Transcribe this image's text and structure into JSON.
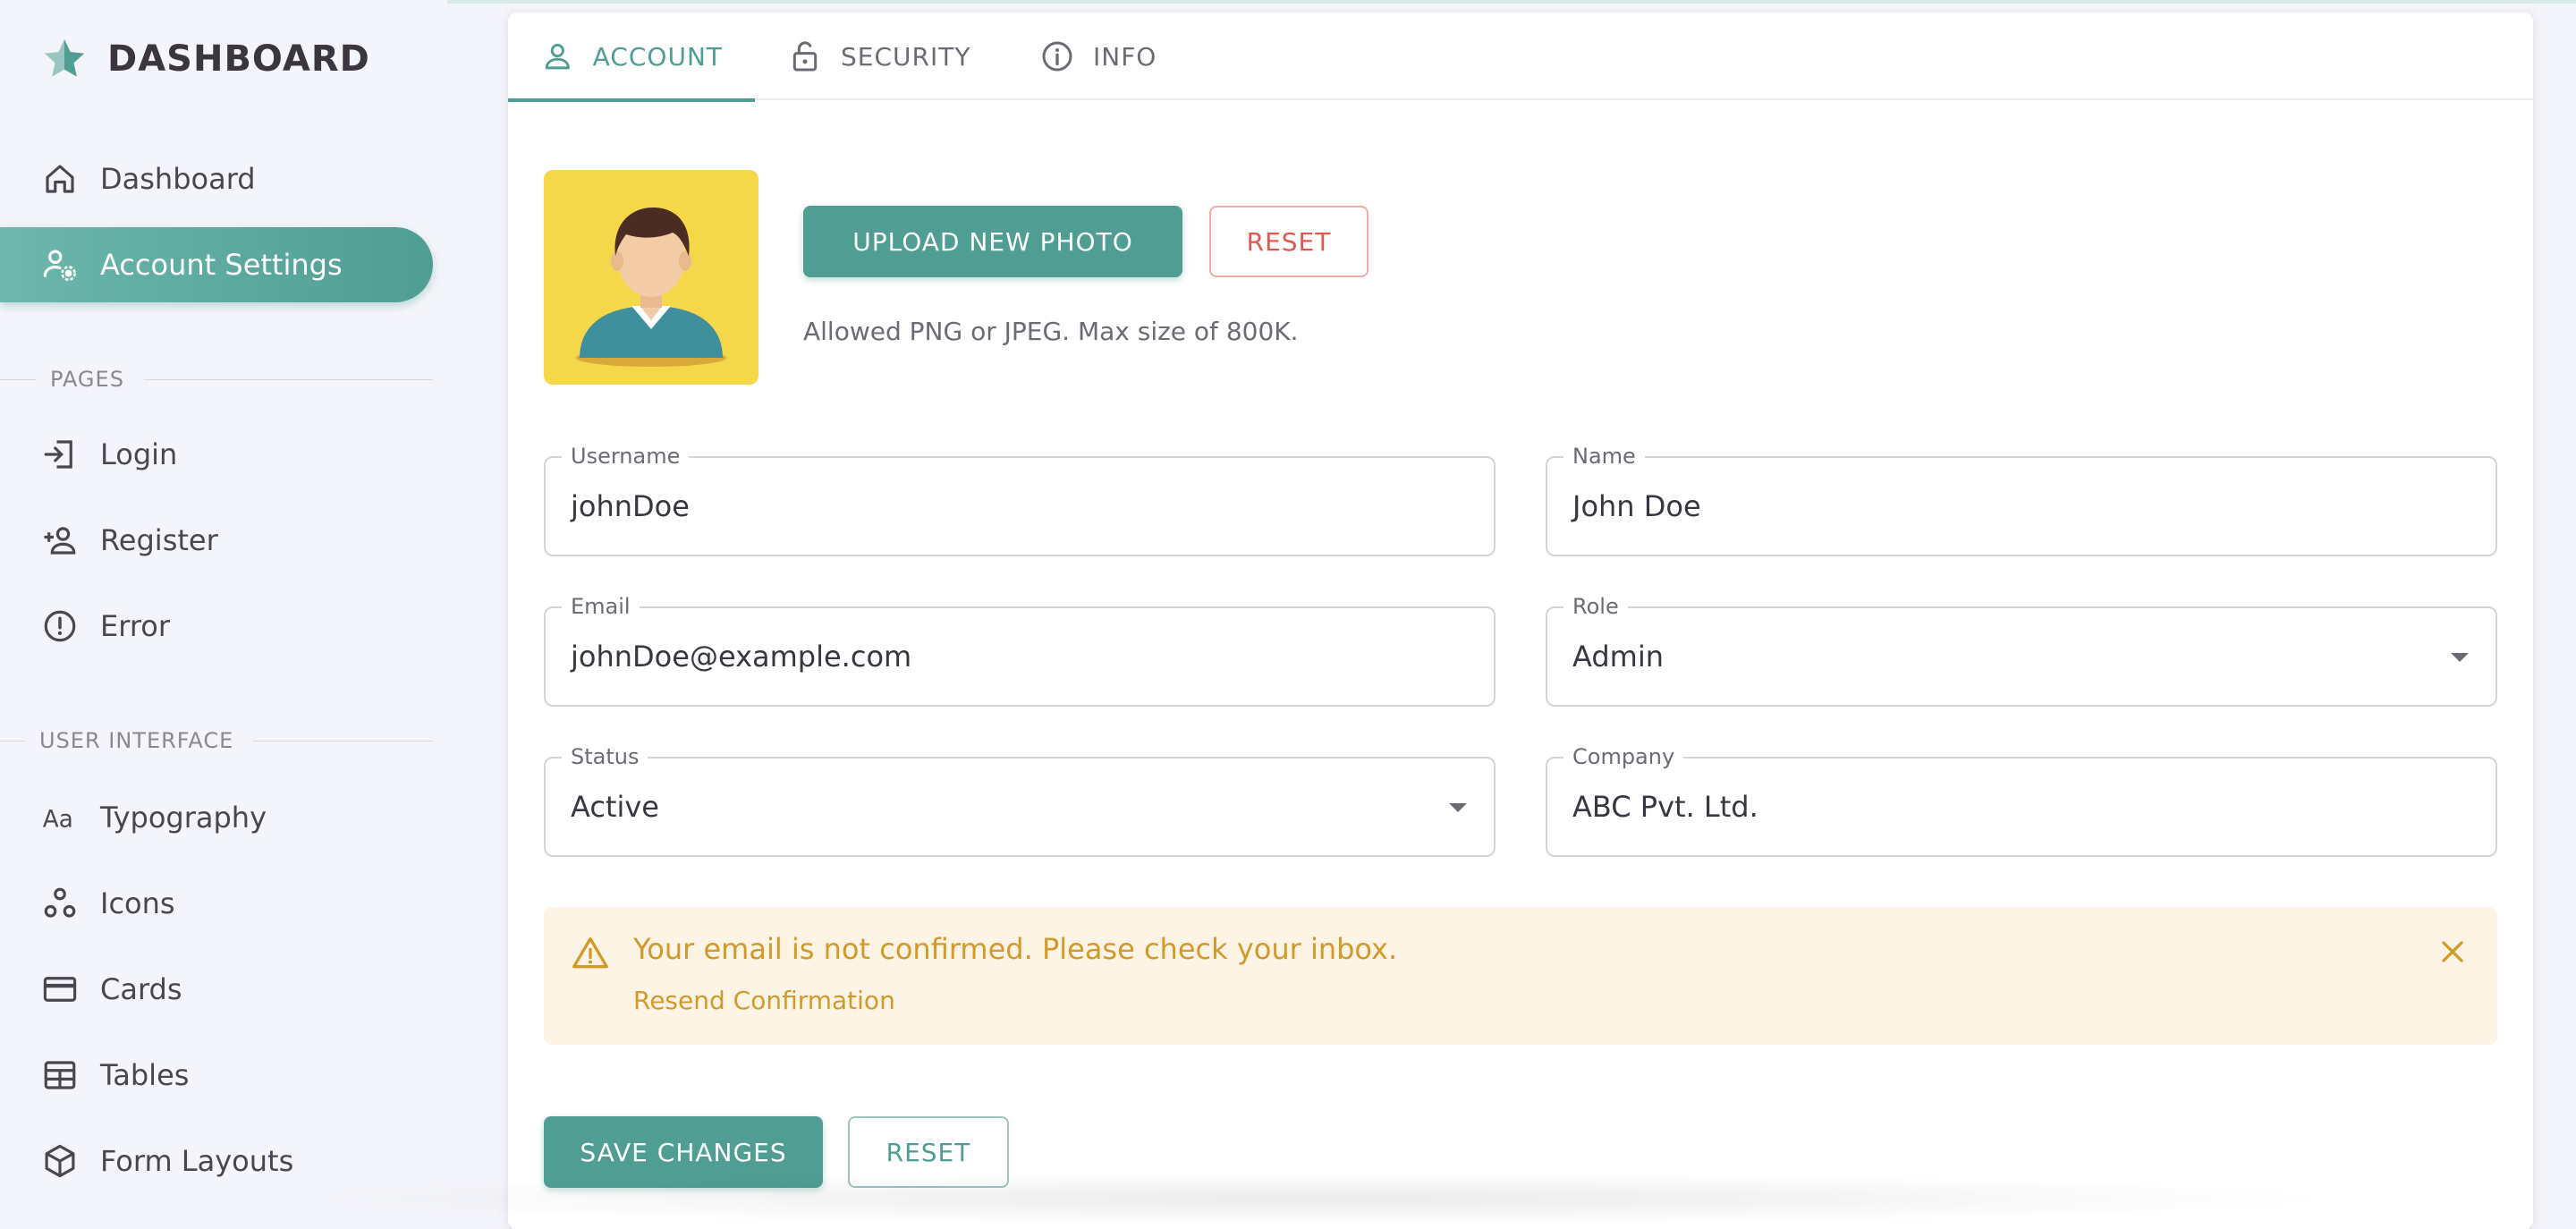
{
  "sidebar": {
    "brand": {
      "title": "DASHBOARD",
      "icon": "star-icon"
    },
    "top_items": [
      {
        "label": "Dashboard",
        "icon": "home-icon",
        "active": false
      },
      {
        "label": "Account Settings",
        "icon": "account-cog-icon",
        "active": true
      }
    ],
    "sections": [
      {
        "title": "PAGES",
        "items": [
          {
            "label": "Login",
            "icon": "login-icon"
          },
          {
            "label": "Register",
            "icon": "account-plus-icon"
          },
          {
            "label": "Error",
            "icon": "alert-circle-icon"
          }
        ]
      },
      {
        "title": "USER INTERFACE",
        "items": [
          {
            "label": "Typography",
            "icon": "typography-icon"
          },
          {
            "label": "Icons",
            "icon": "google-circles-icon"
          },
          {
            "label": "Cards",
            "icon": "credit-card-icon"
          },
          {
            "label": "Tables",
            "icon": "table-icon"
          },
          {
            "label": "Form Layouts",
            "icon": "cube-icon"
          }
        ]
      }
    ]
  },
  "tabs": [
    {
      "label": "ACCOUNT",
      "icon": "account-outline-icon",
      "active": true
    },
    {
      "label": "SECURITY",
      "icon": "lock-open-icon",
      "active": false
    },
    {
      "label": "INFO",
      "icon": "info-icon",
      "active": false
    }
  ],
  "photo": {
    "upload_label": "UPLOAD NEW PHOTO",
    "reset_label": "RESET",
    "hint": "Allowed PNG or JPEG. Max size of 800K."
  },
  "form": {
    "username": {
      "label": "Username",
      "value": "johnDoe"
    },
    "name": {
      "label": "Name",
      "value": "John Doe"
    },
    "email": {
      "label": "Email",
      "value": "johnDoe@example.com"
    },
    "role": {
      "label": "Role",
      "value": "Admin"
    },
    "status": {
      "label": "Status",
      "value": "Active"
    },
    "company": {
      "label": "Company",
      "value": "ABC Pvt. Ltd."
    }
  },
  "alert": {
    "message": "Your email is not confirmed. Please check your inbox.",
    "link": "Resend Confirmation"
  },
  "actions": {
    "save_label": "SAVE CHANGES",
    "reset_label": "RESET"
  },
  "colors": {
    "primary": "#4f9d93",
    "warning": "#d39a2a",
    "warning_bg": "#fef4e6",
    "error": "#e0574f",
    "avatar_bg": "#f5d84a"
  }
}
